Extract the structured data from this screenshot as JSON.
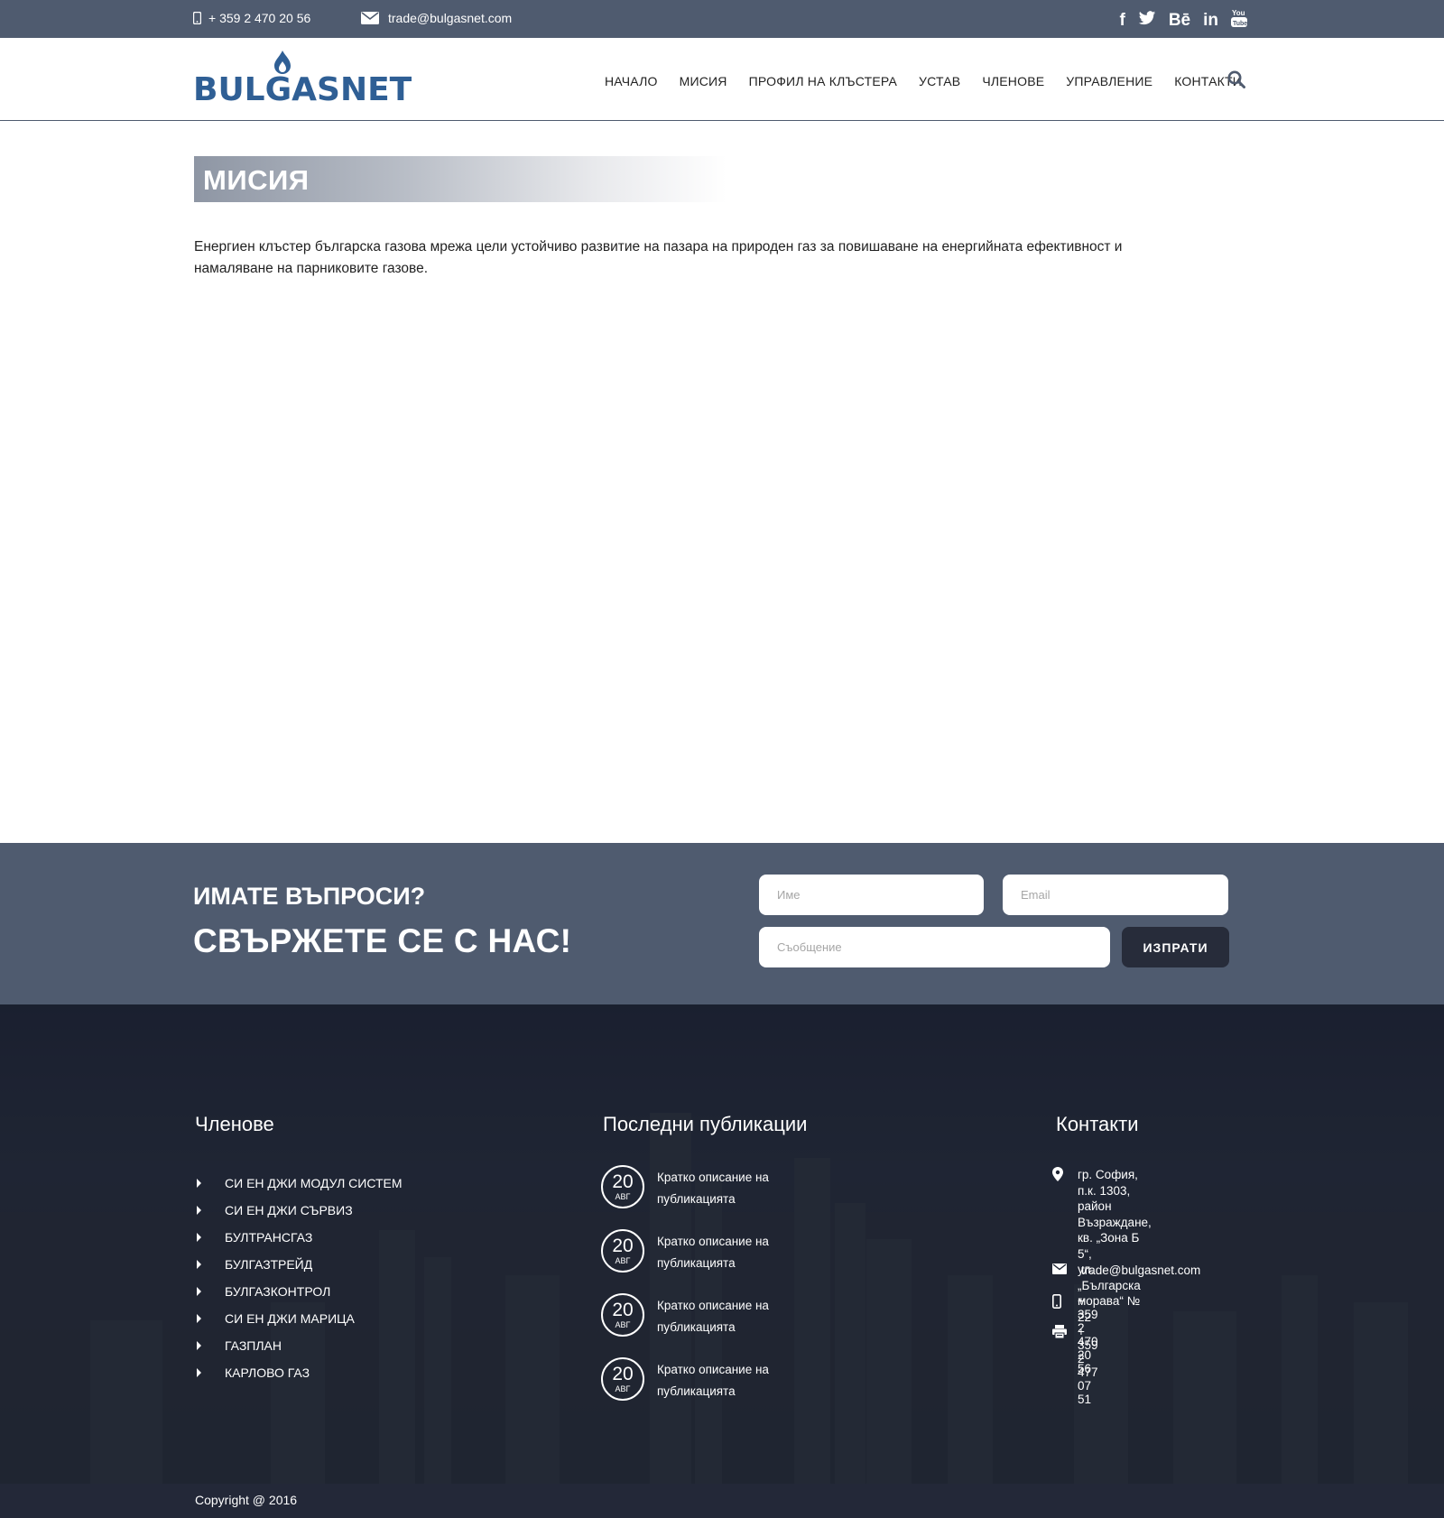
{
  "topbar": {
    "phone": "+ 359 2 470 20 56",
    "email": "trade@bulgasnet.com",
    "social": [
      {
        "icon": "facebook-icon",
        "glyph": "f"
      },
      {
        "icon": "twitter-icon",
        "glyph": "🐦"
      },
      {
        "icon": "behance-icon",
        "glyph": "Bē"
      },
      {
        "icon": "linkedin-icon",
        "glyph": "in"
      },
      {
        "icon": "youtube-icon",
        "glyph": "▶"
      }
    ]
  },
  "header": {
    "logo_text": "BULGASNET",
    "nav": [
      "НАЧАЛО",
      "МИСИЯ",
      "ПРОФИЛ НА КЛЪСТЕРА",
      "УСТАВ",
      "ЧЛЕНОВЕ",
      "УПРАВЛЕНИЕ",
      "КОНТАКТИ"
    ]
  },
  "page": {
    "title": "МИСИЯ",
    "intro": "Енергиен клъстер българска газова мрежа цели устойчиво развитие на пазара на природен газ за повишаване на енергийната ефективност и намаляване на парниковите газове."
  },
  "contact_strip": {
    "question": "ИМАТЕ ВЪПРОСИ?",
    "heading": "СВЪРЖЕТЕ СЕ С НАС!",
    "name_placeholder": "Име",
    "email_placeholder": "Email",
    "message_placeholder": "Съобщение",
    "send_label": "ИЗПРАТИ"
  },
  "footer": {
    "members_title": "Членове",
    "members": [
      "СИ ЕН ДЖИ МОДУЛ СИСТЕМ",
      "СИ ЕН ДЖИ СЪРВИЗ",
      "БУЛТРАНСГАЗ",
      "БУЛГАЗТРЕЙД",
      "БУЛГАЗКОНТРОЛ",
      "СИ ЕН ДЖИ МАРИЦА",
      "ГАЗПЛАН",
      "КАРЛОВО ГАЗ"
    ],
    "pubs_title": "Последни публикации",
    "pubs": [
      {
        "day": "20",
        "month": "АВГ",
        "text": "Кратко описание на публикацията"
      },
      {
        "day": "20",
        "month": "АВГ",
        "text": "Кратко описание на публикацията"
      },
      {
        "day": "20",
        "month": "АВГ",
        "text": "Кратко описание на публикацията"
      },
      {
        "day": "20",
        "month": "АВГ",
        "text": "Кратко описание на публикацията"
      }
    ],
    "contacts_title": "Контакти",
    "address": [
      "гр. София, п.к. 1303,",
      "район Възраждане,",
      "кв. „Зона Б 5“,",
      "ул. „Българска морава“ № 22"
    ],
    "email": "trade@bulgasnet.com",
    "phone": "+ 359 2 470 20 56",
    "fax": "+ 359 2 477 07 51"
  },
  "copyright": "Copyright @ 2016",
  "colors": {
    "accent": "#4f5b6f",
    "dark": "#232838",
    "brand": "#2f5f95"
  }
}
